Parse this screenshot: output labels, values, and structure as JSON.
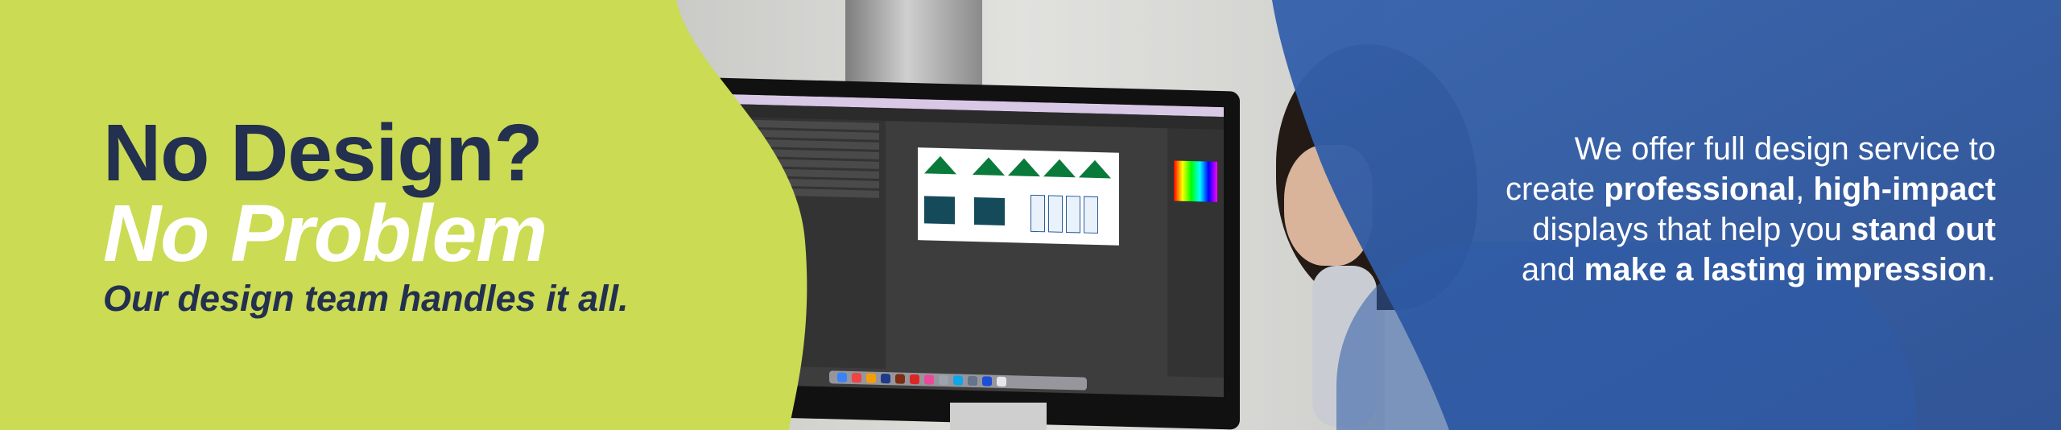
{
  "banner": {
    "headline_line1": "No Design?",
    "headline_line2": "No Problem",
    "subheadline": "Our design team handles it all.",
    "description": {
      "line1_a": "We offer full design service to",
      "line2_a": "create ",
      "line2_b": "professional",
      "line2_c": ", ",
      "line2_d": "high-impact",
      "line3_a": "displays that help you ",
      "line3_b": "stand out",
      "line4_a": "and ",
      "line4_b": "make a lasting impression",
      "line4_c": "."
    }
  },
  "colors": {
    "lime_panel": "#cbdb54",
    "navy_text": "#23304f",
    "blue_panel": "#2f5aa3",
    "white_text": "#ffffff"
  },
  "icons": [
    "monitor-illustration",
    "person-photo"
  ]
}
